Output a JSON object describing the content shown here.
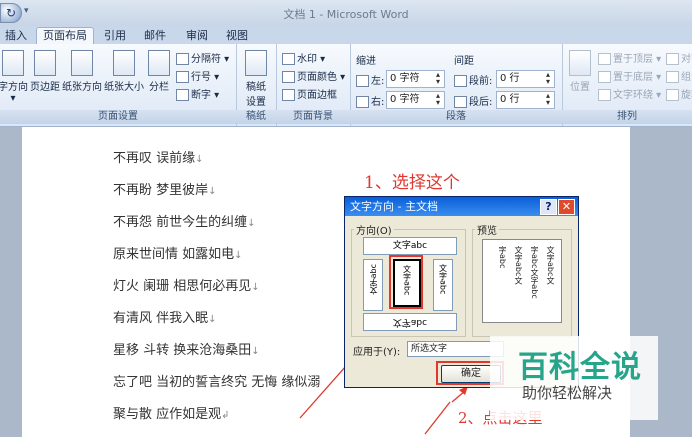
{
  "window": {
    "title": "文档 1 - Microsoft Word"
  },
  "tabs": [
    {
      "label": "插入",
      "active": false
    },
    {
      "label": "页面布局",
      "active": true
    },
    {
      "label": "引用",
      "active": false
    },
    {
      "label": "邮件",
      "active": false
    },
    {
      "label": "审阅",
      "active": false
    },
    {
      "label": "视图",
      "active": false
    }
  ],
  "ribbon": {
    "page_setup": {
      "label": "页面设置",
      "text_direction": "字方向",
      "margins": "页边距",
      "orientation": "纸张方向",
      "size": "纸张大小",
      "columns": "分栏",
      "breaks": "分隔符",
      "line_numbers": "行号",
      "hyphenation": "断字"
    },
    "draft": {
      "label": "稿纸",
      "draft_settings_line1": "稿纸",
      "draft_settings_line2": "设置"
    },
    "page_background": {
      "label": "页面背景",
      "watermark": "水印",
      "page_color": "页面颜色",
      "page_borders": "页面边框"
    },
    "paragraph": {
      "label": "段落",
      "indent": "缩进",
      "spacing": "间距",
      "left_label": "左:",
      "left_value": "0 字符",
      "right_label": "右:",
      "right_value": "0 字符",
      "before_label": "段前:",
      "before_value": "0 行",
      "after_label": "段后:",
      "after_value": "0 行"
    },
    "arrange": {
      "label": "排列",
      "position": "位置",
      "bring_front": "置于顶层",
      "send_back": "置于底层",
      "text_wrap": "文字环绕",
      "align": "对齐",
      "group": "组合",
      "rotate": "旋转"
    }
  },
  "document": {
    "lines": [
      "不再叹 误前缘",
      "不再盼 梦里彼岸",
      "不再怨 前世今生的纠缠",
      "原来世间情 如露如电",
      "灯火 阑珊 相思何必再见",
      "有清风 伴我入眠",
      "星移 斗转 换来沧海桑田",
      "忘了吧 当初的誓言终究 无悔 缘似溺",
      "聚与散 应作如是观"
    ]
  },
  "annotations": {
    "step1": "1、选择这个",
    "step2": "2、点击这里"
  },
  "dialog": {
    "title": "文字方向 - 主文档",
    "help": "?",
    "close": "✕",
    "orientation_label": "方向(O)",
    "option_top": "文字abc",
    "option_left": "文字abc",
    "option_center": "文字abc",
    "option_right": "文字abc",
    "option_bottom": "文字abc",
    "preview_label": "预览",
    "preview_columns": [
      "文字abc文",
      "字abc文字abc",
      "文字abc文",
      "字abc"
    ],
    "apply_label": "应用于(Y):",
    "apply_value": "所选文字",
    "ok_label": "确定"
  },
  "watermark": {
    "main": "百科全说",
    "sub": "助你轻松解决"
  },
  "colors": {
    "accent_red": "#e0382f",
    "watermark_green": "#27a58a",
    "dialog_title": "#0a5fd8"
  }
}
